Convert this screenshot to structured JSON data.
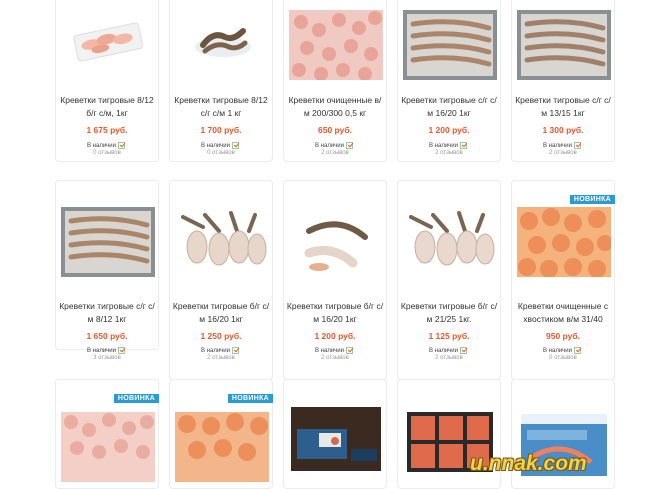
{
  "stock_label": "В наличии",
  "new_badge": "НОВИНКА",
  "watermark": "u.nnak.com",
  "colors": {
    "price": "#e8572b",
    "badge": "#2b9bd6",
    "border": "#ececec"
  },
  "products": [
    {
      "name": "Креветки тигровые 8/12 б/г с/м, 1кг",
      "price": "1 675 руб.",
      "reviews": "0 отзывов",
      "badge": false
    },
    {
      "name": "Креветки тигровые 8/12 с/г с/м 1 кг",
      "price": "1 700 руб.",
      "reviews": "0 отзывов",
      "badge": false
    },
    {
      "name": "Креветки очищенные в/м 200/300 0,5 кг",
      "price": "650 руб.",
      "reviews": "2 отзывов",
      "badge": false
    },
    {
      "name": "Креветки тигровые с/г с/м 16/20 1кг",
      "price": "1 200 руб.",
      "reviews": "2 отзывов",
      "badge": false
    },
    {
      "name": "Креветки тигровые с/г с/м 13/15 1кг",
      "price": "1 300 руб.",
      "reviews": "2 отзывов",
      "badge": false
    },
    {
      "name": "Креветки тигровые с/г с/м 8/12 1кг",
      "price": "1 650 руб.",
      "reviews": "3 отзывов",
      "badge": false
    },
    {
      "name": "Креветки тигровые б/г с/м 16/20 1кг",
      "price": "1 250 руб.",
      "reviews": "2 отзывов",
      "badge": false
    },
    {
      "name": "Креветки тигровые б/г с/м 16/20 1кг",
      "price": "1 200 руб.",
      "reviews": "2 отзывов",
      "badge": false
    },
    {
      "name": "Креветки тигровые б/г с/м 21/25 1кг.",
      "price": "1 125 руб.",
      "reviews": "2 отзывов",
      "badge": false
    },
    {
      "name": "Креветки очищенные с хвостиком в/м 31/40",
      "price": "950 руб.",
      "reviews": "0 отзывов",
      "badge": true
    },
    {
      "badge": true
    },
    {
      "badge": true
    },
    {
      "badge": false
    },
    {
      "badge": false
    },
    {
      "badge": false
    }
  ]
}
